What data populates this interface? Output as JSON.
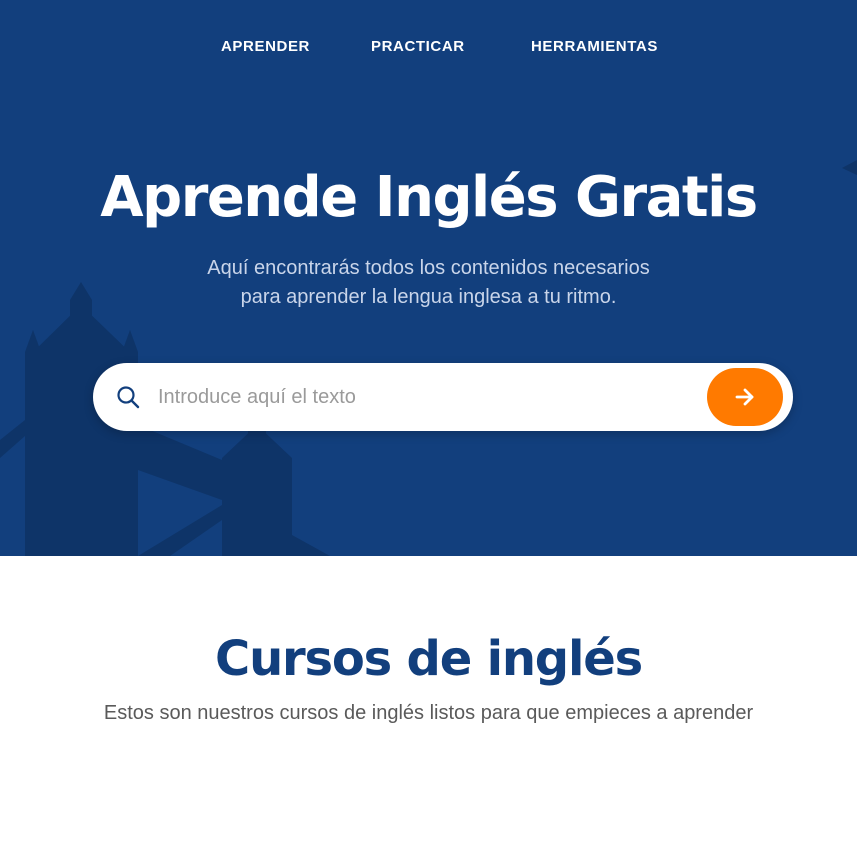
{
  "nav": {
    "items": [
      {
        "label": "APRENDER"
      },
      {
        "label": "PRACTICAR"
      },
      {
        "label": "HERRAMIENTAS"
      }
    ]
  },
  "hero": {
    "title": "Aprende Inglés Gratis",
    "subtitle_lines": [
      "Aquí encontrarás todos los contenidos necesarios",
      "para aprender la lengua inglesa a tu ritmo."
    ]
  },
  "search": {
    "placeholder": "Introduce aquí el texto",
    "value": "",
    "icon": "search-icon",
    "submit_icon": "arrow-right-icon"
  },
  "courses": {
    "title": "Cursos de inglés",
    "subtitle": "Estos son nuestros cursos de inglés listos para que empieces a aprender"
  },
  "colors": {
    "hero_bg": "#123f7d",
    "skyline": "#0e3468",
    "accent": "#ff7a00",
    "heading": "#123f7d",
    "body_text": "#5a5a5a"
  }
}
